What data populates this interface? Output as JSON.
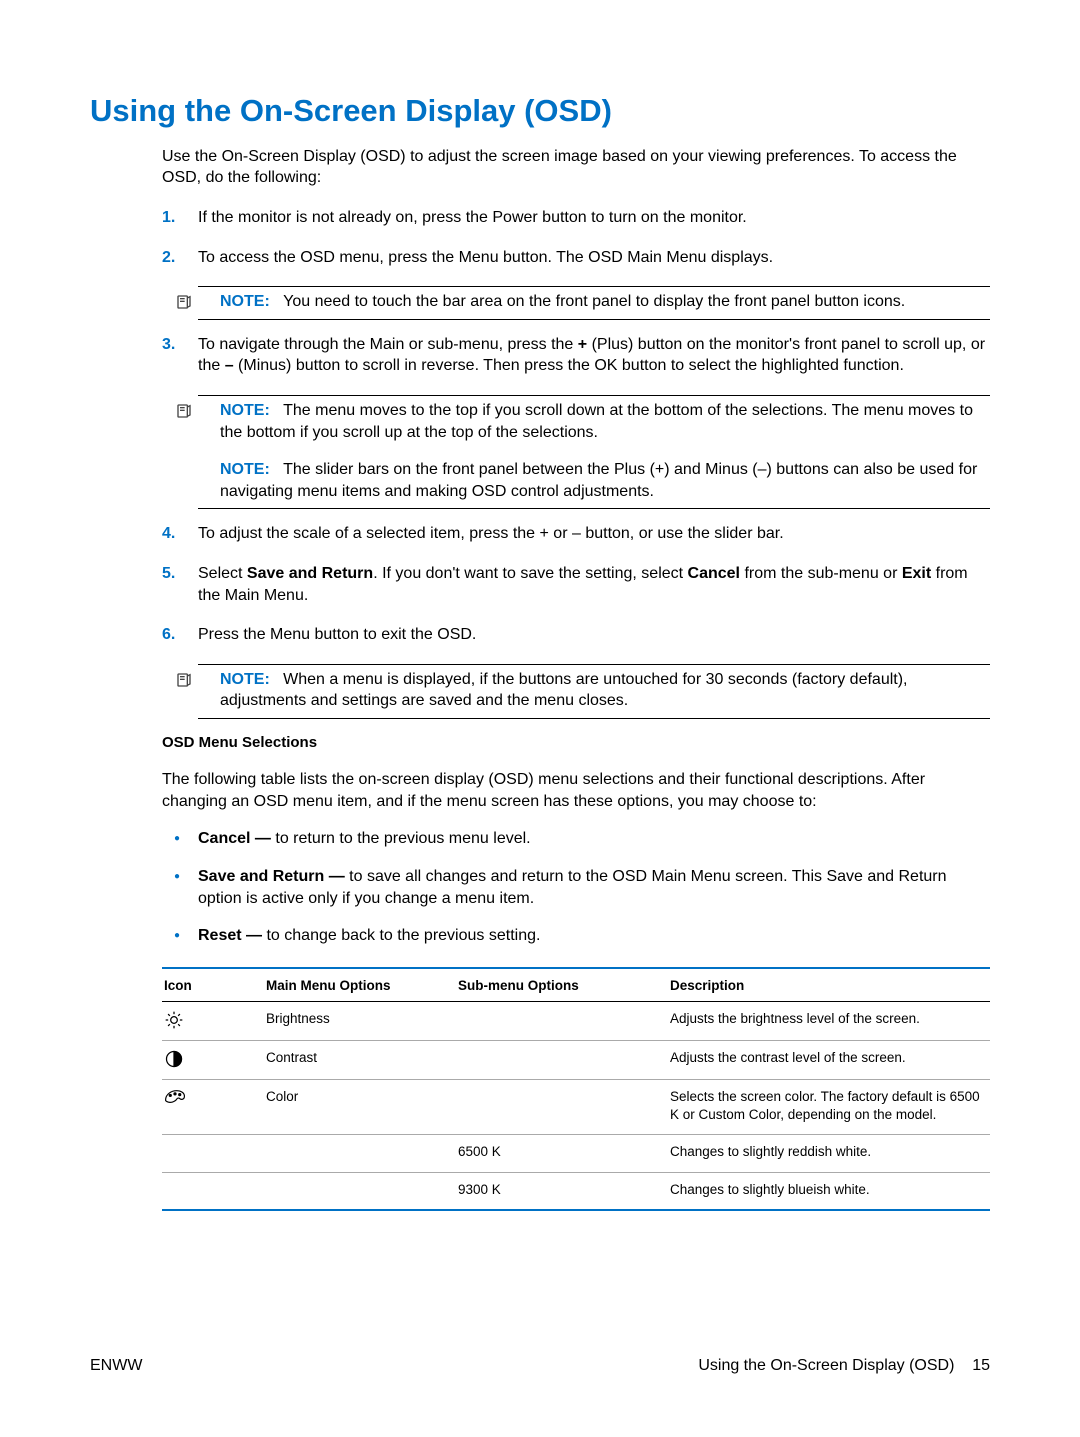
{
  "title": "Using the On-Screen Display (OSD)",
  "intro": "Use the On-Screen Display (OSD) to adjust the screen image based on your viewing preferences. To access the OSD, do the following:",
  "steps": {
    "s1": "If the monitor is not already on, press the Power button to turn on the monitor.",
    "s2": "To access the OSD menu, press the Menu button. The OSD Main Menu displays.",
    "note2": "You need to touch the bar area on the front panel to display the front panel button icons.",
    "s3_a": "To navigate through the Main or sub-menu, press the ",
    "s3_plus": "+",
    "s3_b": " (Plus) button on the monitor's front panel to scroll up, or the ",
    "s3_minus": "–",
    "s3_c": " (Minus) button to scroll in reverse. Then press the OK button to select the highlighted function.",
    "note3a": "The menu moves to the top if you scroll down at the bottom of the selections. The menu moves to the bottom if you scroll up at the top of the selections.",
    "note3b": "The slider bars on the front panel between the Plus (+) and Minus (–) buttons can also be used for navigating menu items and making OSD control adjustments.",
    "s4": "To adjust the scale of a selected item, press the + or – button, or use the slider bar.",
    "s5_a": "Select ",
    "s5_bold1": "Save and Return",
    "s5_b": ". If you don't want to save the setting, select ",
    "s5_bold2": "Cancel",
    "s5_c": " from the sub-menu or ",
    "s5_bold3": "Exit",
    "s5_d": " from the Main Menu.",
    "s6": "Press the Menu button to exit the OSD.",
    "note6": "When a menu is displayed, if the buttons are untouched for 30 seconds (factory default), adjustments and settings are saved and the menu closes."
  },
  "note_label": "NOTE:",
  "subhead": "OSD Menu Selections",
  "selections_intro": "The following table lists the on-screen display (OSD) menu selections and their functional descriptions. After changing an OSD menu item, and if the menu screen has these options, you may choose to:",
  "bullets": {
    "cancel_label": "Cancel —",
    "cancel_text": " to return to the previous menu level.",
    "save_label": "Save and Return —",
    "save_text": " to save all changes and return to the OSD Main Menu screen. This Save and Return option is active only if you change a menu item.",
    "reset_label": "Reset —",
    "reset_text": " to change back to the previous setting."
  },
  "table": {
    "headers": {
      "icon": "Icon",
      "main": "Main Menu Options",
      "sub": "Sub-menu Options",
      "desc": "Description"
    },
    "rows": {
      "brightness": {
        "main": "Brightness",
        "sub": "",
        "desc": "Adjusts the brightness level of the screen."
      },
      "contrast": {
        "main": "Contrast",
        "sub": "",
        "desc": "Adjusts the contrast level of the screen."
      },
      "color": {
        "main": "Color",
        "sub": "",
        "desc": "Selects the screen color. The factory default is 6500 K or Custom Color, depending on the model."
      },
      "c6500": {
        "main": "",
        "sub": "6500 K",
        "desc": "Changes to slightly reddish white."
      },
      "c9300": {
        "main": "",
        "sub": "9300 K",
        "desc": "Changes to slightly blueish white."
      }
    }
  },
  "footer": {
    "left": "ENWW",
    "right_label": "Using the On-Screen Display (OSD)",
    "page": "15"
  }
}
